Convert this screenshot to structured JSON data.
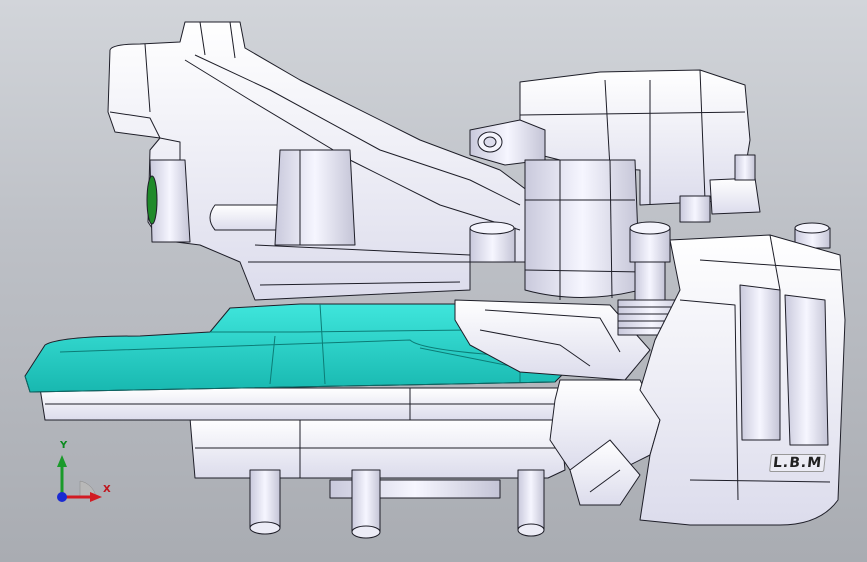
{
  "viewport": {
    "background_top": "#d2d5da",
    "background_bottom": "#a9acb2"
  },
  "model": {
    "name": "caliper-bracket-assembly-model",
    "body_color": "#f2f2fb",
    "edge_color": "#1e1e28",
    "shield_color": "#22d2c8",
    "shield_dark_color": "#10a098",
    "accent_green": "#1f8a2a",
    "part_label_text": "L.B.M"
  },
  "triad": {
    "x_label": "X",
    "y_label": "Y",
    "x_color": "#d21a22",
    "y_color": "#1a9a2a",
    "z_color": "#1a2ad2"
  }
}
